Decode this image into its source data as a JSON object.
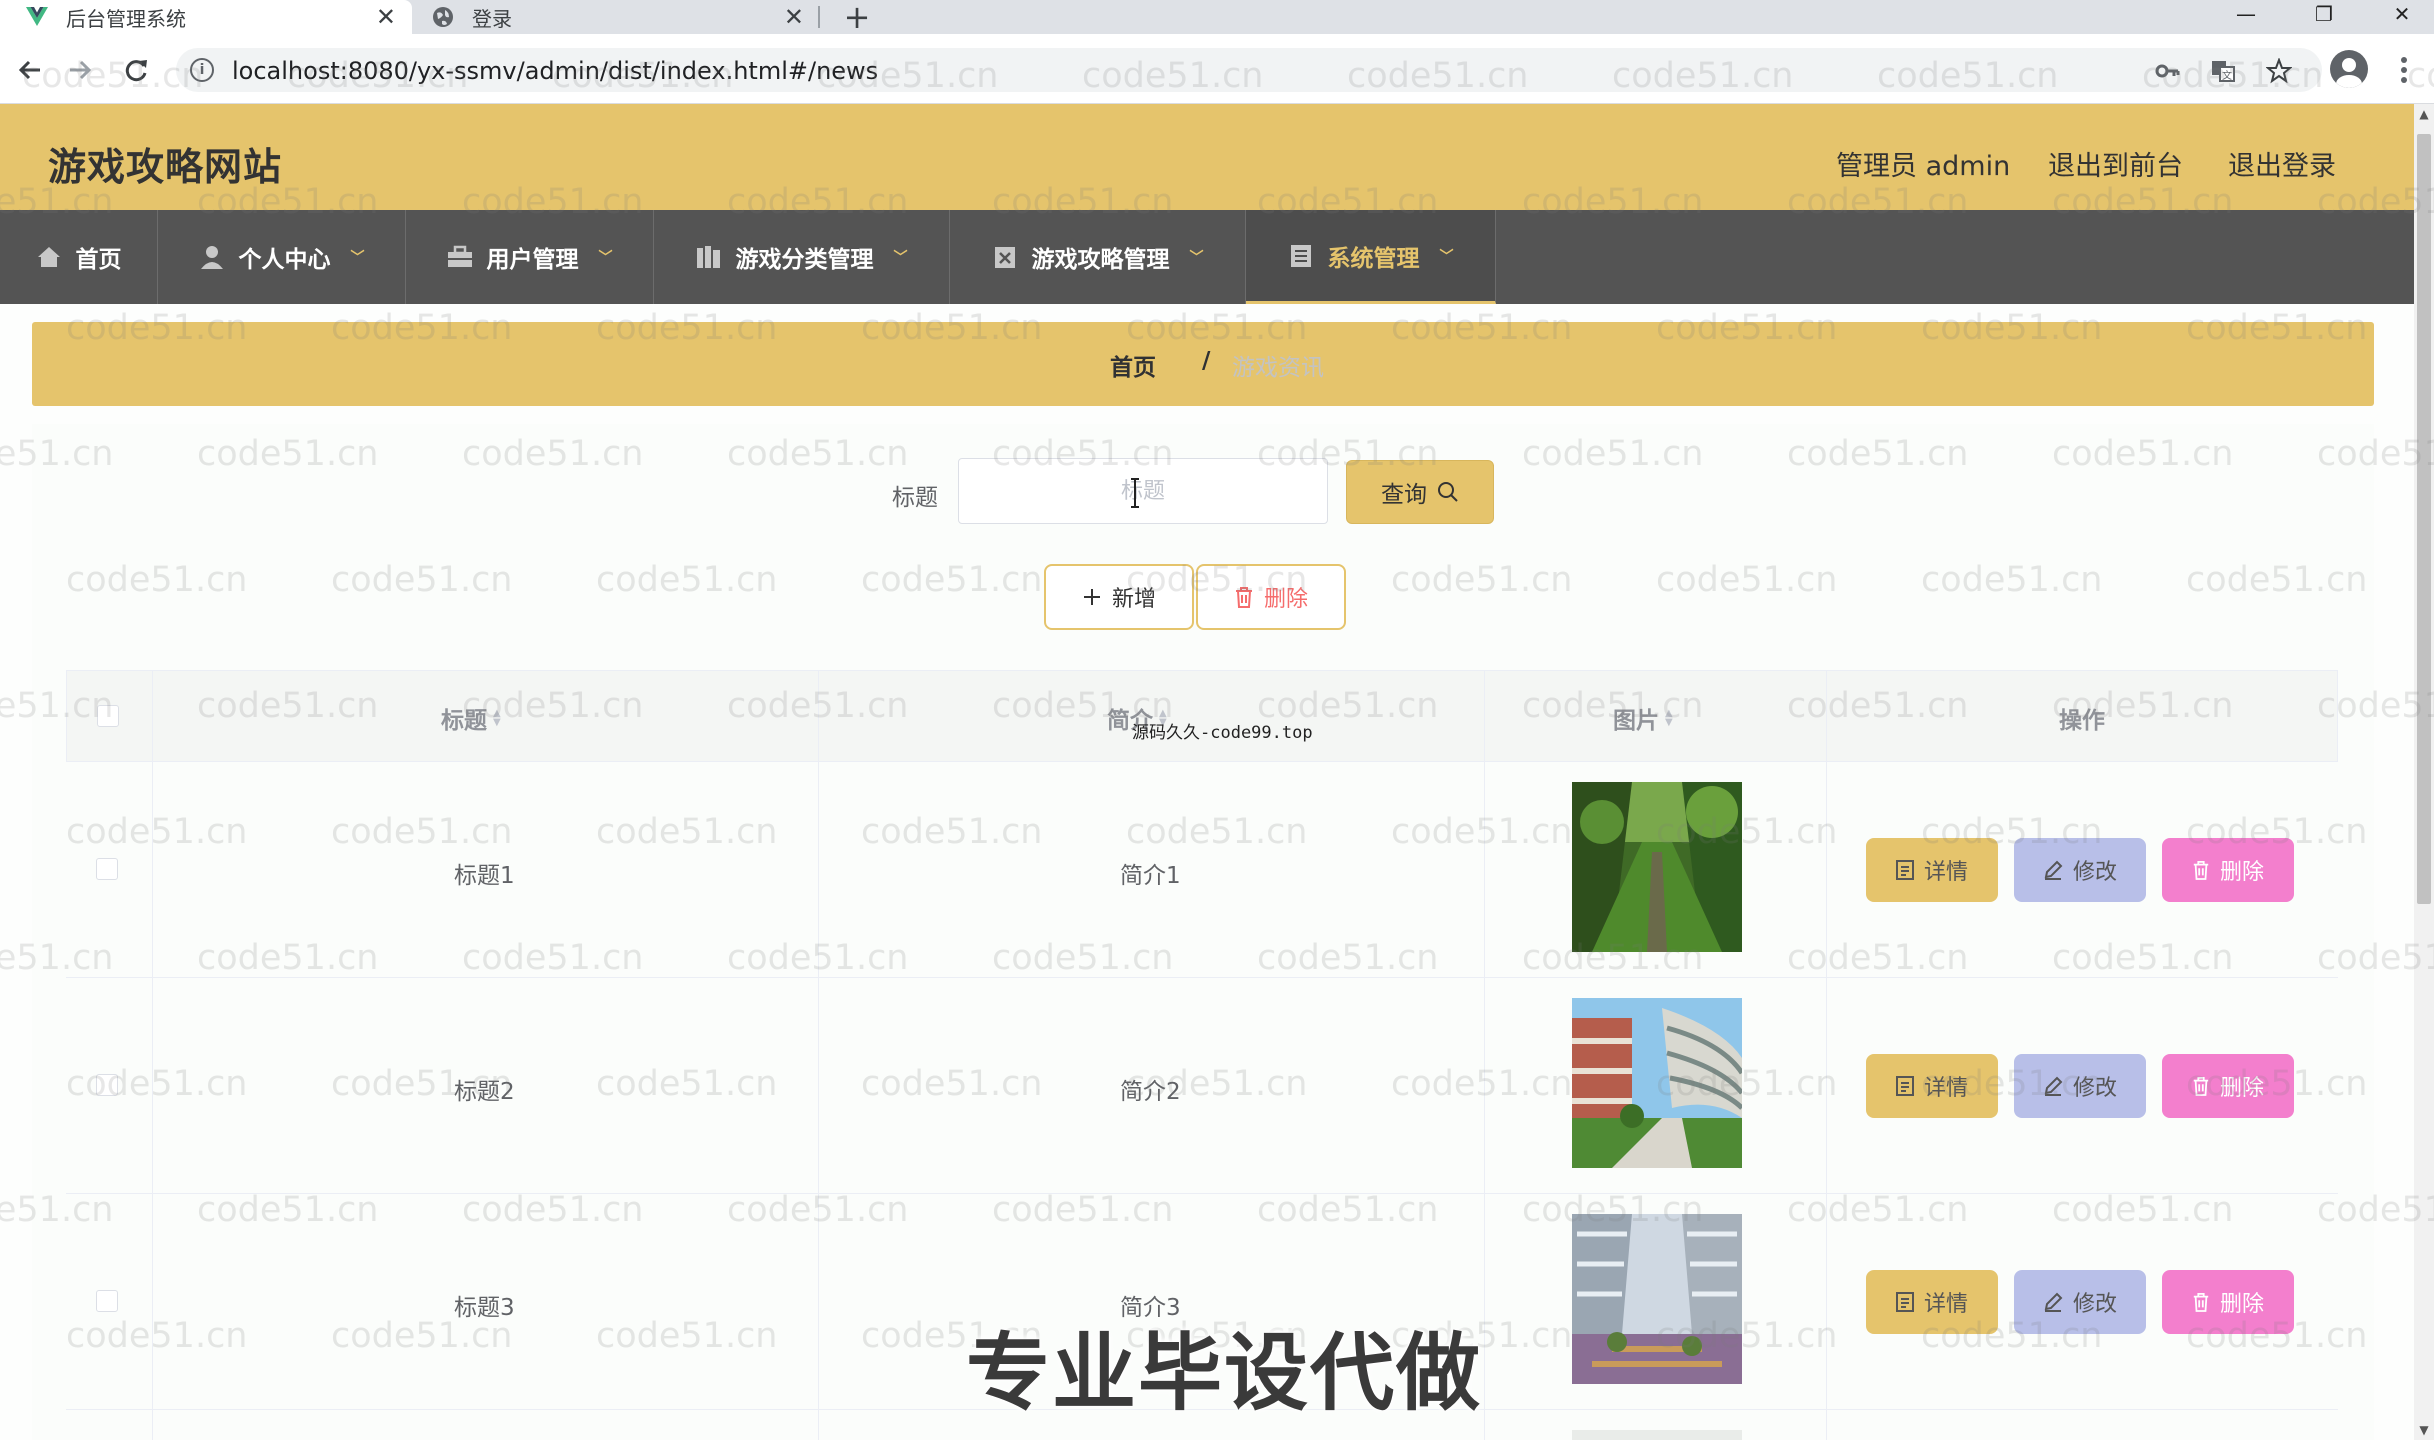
{
  "browser": {
    "tabs": [
      {
        "title": "后台管理系统",
        "active": true,
        "favicon": "vue-logo-icon"
      },
      {
        "title": "登录",
        "active": false,
        "favicon": "globe-icon"
      }
    ],
    "new_tab": "+",
    "close_glyph": "✕",
    "url": "localhost:8080/yx-ssmv/admin/dist/index.html#/news",
    "window_controls": [
      "—",
      "❐",
      "✕"
    ]
  },
  "site": {
    "title": "游戏攻略网站",
    "admin_label": "管理员 admin",
    "to_front_label": "退出到前台",
    "logout_label": "退出登录"
  },
  "nav": {
    "items": [
      {
        "label": "首页",
        "icon": "home-icon",
        "has_dropdown": false,
        "active": false
      },
      {
        "label": "个人中心",
        "icon": "user-icon",
        "has_dropdown": true,
        "active": false
      },
      {
        "label": "用户管理",
        "icon": "briefcase-icon",
        "has_dropdown": true,
        "active": false
      },
      {
        "label": "游戏分类管理",
        "icon": "books-icon",
        "has_dropdown": true,
        "active": false
      },
      {
        "label": "游戏攻略管理",
        "icon": "clipboard-icon",
        "has_dropdown": true,
        "active": false
      },
      {
        "label": "系统管理",
        "icon": "document-icon",
        "has_dropdown": true,
        "active": true
      }
    ],
    "accent": "#e5c46c"
  },
  "breadcrumb": {
    "home": "首页",
    "separator": "/",
    "current": "游戏资讯"
  },
  "search": {
    "label": "标题",
    "placeholder": "标题",
    "value": "",
    "button_label": "查询"
  },
  "toolbar": {
    "add_label": "新增",
    "delete_label": "删除"
  },
  "table": {
    "columns": [
      "标题",
      "简介",
      "图片",
      "操作"
    ],
    "rows": [
      {
        "title": "标题1",
        "intro": "简介1",
        "image": "tree-lined path"
      },
      {
        "title": "标题2",
        "intro": "简介2",
        "image": "campus building"
      },
      {
        "title": "标题3",
        "intro": "简介3",
        "image": "atrium courtyard"
      }
    ],
    "actions": {
      "detail": "详情",
      "edit": "修改",
      "delete": "删除"
    }
  },
  "overlays": {
    "watermark": "code51.cn",
    "source_caption": "源码久久-code99.top",
    "banner": "专业毕设代做"
  },
  "colors": {
    "header": "#e5c46c",
    "nav": "#545454",
    "detail_button": "#e5c46c",
    "edit_button": "#b8bfe8",
    "delete_button": "#f37fcd",
    "danger_text": "#f56c6c"
  }
}
